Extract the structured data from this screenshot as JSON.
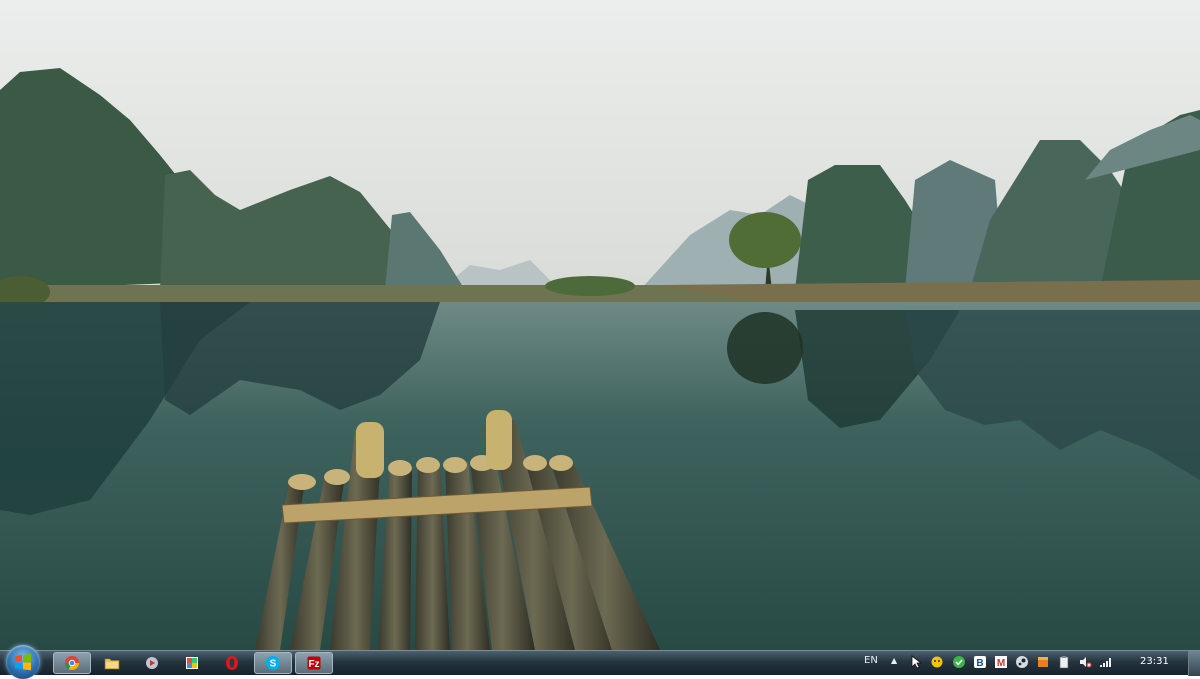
{
  "desktop": {
    "wallpaper_icon": "landscape-wallpaper"
  },
  "taskbar": {
    "start_icon": "windows-logo-icon",
    "apps": [
      {
        "icon": "chrome-icon",
        "active": true
      },
      {
        "icon": "folder-icon",
        "active": false
      },
      {
        "icon": "media-player-icon",
        "active": false
      },
      {
        "icon": "picture-viewer-icon",
        "active": false
      },
      {
        "icon": "opera-icon",
        "active": false
      },
      {
        "icon": "skype-icon",
        "active": true
      },
      {
        "icon": "filezilla-icon",
        "active": true
      }
    ],
    "tray": {
      "language": "EN",
      "expand_arrow": "▲",
      "icons": [
        "cursor-icon",
        "chat-icon",
        "green-app-icon",
        "b-app-icon",
        "m-app-icon",
        "steam-icon",
        "box-app-icon",
        "clipboard-icon",
        "volume-muted-icon",
        "network-signal-icon"
      ],
      "time": "23:31"
    }
  },
  "colors": {
    "taskbar_top": "#4b6170",
    "taskbar_bottom": "#17222b",
    "water": "#2f5551",
    "sky": "#e6e6e3"
  }
}
